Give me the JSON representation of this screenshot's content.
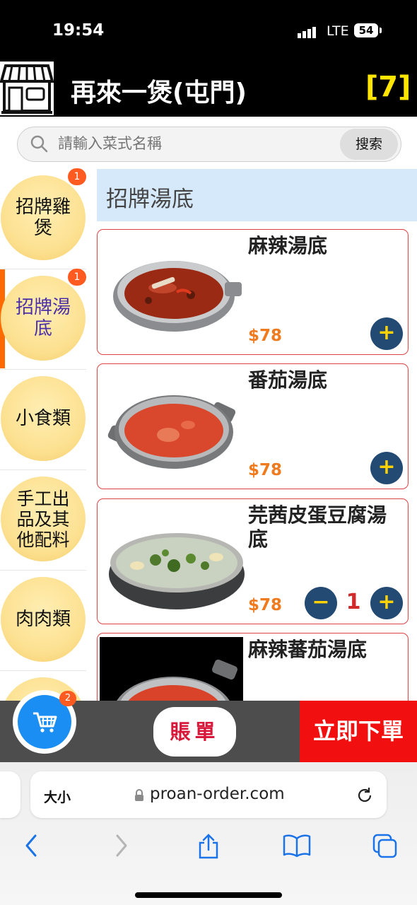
{
  "status_bar": {
    "time": "19:54",
    "network": "LTE",
    "battery": "54"
  },
  "header": {
    "title": "再來一煲(屯門)",
    "table_number": "[7]"
  },
  "search": {
    "placeholder": "請輸入菜式名稱",
    "button": "搜索"
  },
  "categories": [
    {
      "label": "招牌雞煲",
      "badge": "1",
      "active": false
    },
    {
      "label": "招牌湯底",
      "badge": "1",
      "active": true
    },
    {
      "label": "小食類",
      "badge": "",
      "active": false
    },
    {
      "label": "手工出品及其他配料",
      "badge": "",
      "active": false
    },
    {
      "label": "肉肉類",
      "badge": "",
      "active": false
    }
  ],
  "section_title": "招牌湯底",
  "items": [
    {
      "name": "麻辣湯底",
      "price": "$78",
      "quantity": ""
    },
    {
      "name": "番茄湯底",
      "price": "$78",
      "quantity": ""
    },
    {
      "name": "芫茜皮蛋豆腐湯底",
      "price": "$78",
      "quantity": "1"
    },
    {
      "name": "麻辣蕃茄湯底",
      "price": "",
      "quantity": ""
    }
  ],
  "item_controls": {
    "plus": "+",
    "minus": "−"
  },
  "bottom_bar": {
    "cart_count": "2",
    "bill": "賬單",
    "order_now": "立即下單"
  },
  "browser": {
    "text_size": "大小",
    "url": "proan-order.com"
  },
  "colors": {
    "accent_orange": "#ff6a00",
    "price": "#f07a1e",
    "button_navy": "#234a73",
    "order_red": "#f20f0f",
    "bill_red": "#d8183a",
    "table_yellow": "#ffe500"
  }
}
